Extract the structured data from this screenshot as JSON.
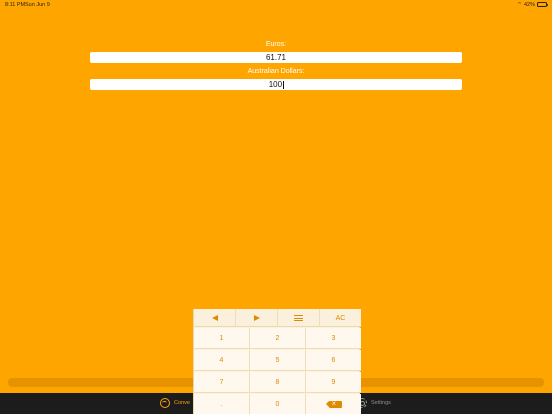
{
  "status_bar": {
    "time": "8:11 PM",
    "date": "Sun Jun 9",
    "battery": "42%"
  },
  "converter": {
    "from_label": "Euros:",
    "from_value": "61.71",
    "to_label": "Australian Dollars:",
    "to_value": "100"
  },
  "keypad": {
    "top_row": [
      {
        "icon": "left-arrow-icon"
      },
      {
        "icon": "right-arrow-icon"
      },
      {
        "icon": "menu-icon"
      },
      {
        "label": "AC"
      }
    ],
    "rows": [
      [
        "1",
        "2",
        "3"
      ],
      [
        "4",
        "5",
        "6"
      ],
      [
        "7",
        "8",
        "9"
      ],
      [
        ".",
        "0",
        "backspace-icon"
      ]
    ]
  },
  "tab_bar": {
    "convert_label": "Conve",
    "settings_label": "Settings"
  },
  "colors": {
    "background": "#FFA500",
    "accent": "#E08A00"
  }
}
